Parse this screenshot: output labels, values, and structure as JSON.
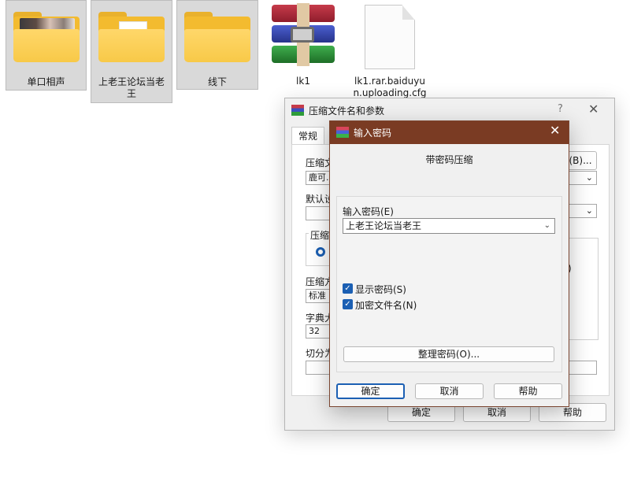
{
  "desktop": {
    "icons": [
      {
        "label": "单口相声",
        "type": "folder-photo"
      },
      {
        "label": "上老王论坛当老王",
        "type": "folder-doc"
      },
      {
        "label": "线下",
        "type": "folder"
      },
      {
        "label": "lk1",
        "type": "winrar-archive"
      },
      {
        "label": "lk1.rar.baiduyun.uploading.cfg",
        "type": "generic-file"
      }
    ]
  },
  "archive_dialog": {
    "title": "压缩文件名和参数",
    "help_glyph": "?",
    "close_glyph": "✕",
    "tab_general": "常规",
    "archive_name_label": "压缩文",
    "archive_name_value": "鹿可.r",
    "browse_button": "(B)...",
    "default_profile_label": "默认设",
    "format_group_label": "压缩",
    "method_label": "压缩方",
    "method_value": "标准",
    "dict_label": "字典大",
    "dict_value": "32",
    "split_label": "切分为",
    "right_paren": ")",
    "ok_button": "确定",
    "cancel_button": "取消",
    "help_button": "帮助"
  },
  "password_dialog": {
    "title": "输入密码",
    "close_glyph": "✕",
    "heading": "带密码压缩",
    "password_label": "输入密码(E)",
    "password_value": "上老王论坛当老王",
    "show_password_label": "显示密码(S)",
    "show_password_checked": true,
    "encrypt_filenames_label": "加密文件名(N)",
    "encrypt_filenames_checked": true,
    "organize_button": "整理密码(O)...",
    "ok_button": "确定",
    "cancel_button": "取消",
    "help_button": "帮助"
  },
  "colors": {
    "password_titlebar": "#7a3b23",
    "accent": "#1b5fb3"
  }
}
